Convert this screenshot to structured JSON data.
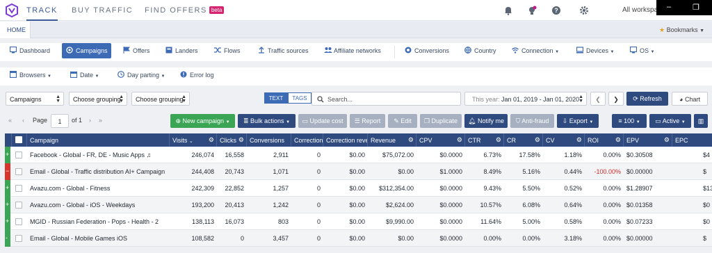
{
  "topnav": {
    "items": [
      "TRACK",
      "BUY TRAFFIC",
      "FIND OFFERS"
    ],
    "beta": "beta",
    "workspace": "All workspa"
  },
  "window_controls": {
    "minimize": "–",
    "restore": "❐"
  },
  "home": {
    "tab": "HOME",
    "bookmarks": "Bookmarks"
  },
  "nav1": [
    {
      "label": "Dashboard",
      "icon": "monitor-icon"
    },
    {
      "label": "Campaigns",
      "icon": "target-icon",
      "active": true
    },
    {
      "label": "Offers",
      "icon": "flag-icon"
    },
    {
      "label": "Landers",
      "icon": "square-icon"
    },
    {
      "label": "Flows",
      "icon": "shuffle-icon"
    },
    {
      "label": "Traffic sources",
      "icon": "upload-icon"
    },
    {
      "label": "Affiliate networks",
      "icon": "users-icon"
    },
    {
      "label": "Conversions",
      "icon": "coin-icon"
    },
    {
      "label": "Country",
      "icon": "globe-icon"
    },
    {
      "label": "Connection",
      "icon": "wifi-icon"
    },
    {
      "label": "Devices",
      "icon": "device-icon"
    },
    {
      "label": "OS",
      "icon": "desktop-icon"
    }
  ],
  "nav2": [
    {
      "label": "Browsers",
      "icon": "browser-icon"
    },
    {
      "label": "Date",
      "icon": "calendar-icon"
    },
    {
      "label": "Day parting",
      "icon": "clock-icon"
    },
    {
      "label": "Error log",
      "icon": "alert-icon"
    }
  ],
  "toolbar": {
    "entity": "Campaigns",
    "grouping1": "Choose grouping",
    "grouping2": "Choose grouping",
    "seg_text": "TEXT",
    "seg_tags": "TAGS",
    "search_placeholder": "Search...",
    "date_prefix": "This year:",
    "date_range": "Jan 01, 2019 - Jan 01, 2020",
    "refresh": "Refresh",
    "chart": "Chart"
  },
  "pager": {
    "label": "Page",
    "page": "1",
    "of": "of 1"
  },
  "actions": {
    "new_campaign": "New campaign",
    "bulk": "Bulk actions",
    "update_cost": "Update cost",
    "report": "Report",
    "edit": "Edit",
    "duplicate": "Duplicate",
    "notify": "Notify me",
    "antifraud": "Anti-fraud",
    "export": "Export",
    "perpage": "100",
    "status": "Active"
  },
  "columns": [
    "Campaign",
    "Visits",
    "Clicks",
    "Conversions",
    "Correction",
    "Correction reve",
    "Revenue",
    "CPV",
    "CTR",
    "CR",
    "CV",
    "ROI",
    "EPV",
    "EPC"
  ],
  "rows": [
    {
      "flag": "+",
      "color": "#3aa655",
      "name": "Facebook - Global - FR, DE - Music Apps ♫",
      "visits": "246,074",
      "clicks": "16,558",
      "conv": "2,911",
      "corr": "0",
      "corrrev": "$0.00",
      "rev": "$75,072.00",
      "cpv": "$0.0000",
      "ctr": "6.73%",
      "cr": "17.58%",
      "cv": "1.18%",
      "roi": "0.00%",
      "epv": "$0.30508",
      "epc": "$4"
    },
    {
      "flag": "−",
      "color": "#d9342b",
      "name": "Email - Global - Traffic distribution AI+ Campaign",
      "visits": "244,408",
      "clicks": "20,743",
      "conv": "1,071",
      "corr": "0",
      "corrrev": "$0.00",
      "rev": "$0.00",
      "cpv": "$1.0000",
      "ctr": "8.49%",
      "cr": "5.16%",
      "cv": "0.44%",
      "roi": "-100.00%",
      "epv": "$0.00000",
      "epc": "$"
    },
    {
      "flag": "+",
      "color": "#3aa655",
      "name": "Avazu.com - Global - Fitness",
      "visits": "242,309",
      "clicks": "22,852",
      "conv": "1,257",
      "corr": "0",
      "corrrev": "$0.00",
      "rev": "$312,354.00",
      "cpv": "$0.0000",
      "ctr": "9.43%",
      "cr": "5.50%",
      "cv": "0.52%",
      "roi": "0.00%",
      "epv": "$1.28907",
      "epc": "$13"
    },
    {
      "flag": "+",
      "color": "#3aa655",
      "name": "Avazu.com - Global - iOS - Weekdays",
      "visits": "193,200",
      "clicks": "20,413",
      "conv": "1,242",
      "corr": "0",
      "corrrev": "$0.00",
      "rev": "$2,624.00",
      "cpv": "$0.0000",
      "ctr": "10.57%",
      "cr": "6.08%",
      "cv": "0.64%",
      "roi": "0.00%",
      "epv": "$0.01358",
      "epc": "$0"
    },
    {
      "flag": "+",
      "color": "#3aa655",
      "name": "MGID - Russian Federation - Pops - Health - 2",
      "visits": "138,113",
      "clicks": "16,073",
      "conv": "803",
      "corr": "0",
      "corrrev": "$0.00",
      "rev": "$9,990.00",
      "cpv": "$0.0000",
      "ctr": "11.64%",
      "cr": "5.00%",
      "cv": "0.58%",
      "roi": "0.00%",
      "epv": "$0.07233",
      "epc": "$0"
    },
    {
      "flag": "-",
      "color": "#3aa655",
      "name": "Email - Global - Mobile Games iOS",
      "visits": "108,582",
      "clicks": "0",
      "conv": "3,457",
      "corr": "0",
      "corrrev": "$0.00",
      "rev": "$0.00",
      "cpv": "$0.0000",
      "ctr": "0.00%",
      "cr": "0.00%",
      "cv": "3.18%",
      "roi": "0.00%",
      "epv": "$0.00000",
      "epc": "$"
    }
  ]
}
